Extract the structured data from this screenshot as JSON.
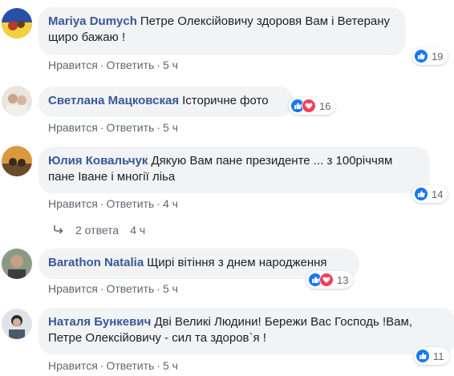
{
  "colors": {
    "author": "#385898",
    "bubble": "#f2f3f5",
    "meta": "#606770",
    "like": "#1877f2",
    "love": "#f33e58"
  },
  "comments": [
    {
      "author": "Mariya Dumych",
      "text": "Петре Олексійовичу здоровя Вам і Ветерану щиро бажаю !",
      "like_label": "Нравится",
      "reply_label": "Ответить",
      "time": "5 ч",
      "reaction_count": "19",
      "reactions": [
        "like-icon"
      ]
    },
    {
      "author": "Светлана Мацковская",
      "text": "Історичне фото",
      "like_label": "Нравится",
      "reply_label": "Ответить",
      "time": "5 ч",
      "reaction_count": "16",
      "reactions": [
        "like-icon",
        "love-icon"
      ]
    },
    {
      "author": "Юлия Ковальчук",
      "text": "Дякую Вам пане президенте ... з 100річчям пане Іване і многії ліьа",
      "like_label": "Нравится",
      "reply_label": "Ответить",
      "time": "4 ч",
      "reaction_count": "14",
      "reactions": [
        "like-icon"
      ]
    },
    {
      "author": "Barathon Natalia",
      "text": "Щирі вітіння з днем народження",
      "like_label": "Нравится",
      "reply_label": "Ответить",
      "time": "5 ч",
      "reaction_count": "13",
      "reactions": [
        "like-icon",
        "love-icon"
      ]
    },
    {
      "author": "Наталя Бункевич",
      "text": "Дві Великі Людини! Бережи Вас Господь !Вам, Петре Олексійовичу - сил та здоров`я !",
      "like_label": "Нравится",
      "reply_label": "Ответить",
      "time": "5 ч",
      "reaction_count": "11",
      "reactions": [
        "like-icon"
      ]
    }
  ],
  "replies_link": {
    "label": "2 ответа",
    "time": "4 ч",
    "icon": "reply-arrow-icon"
  }
}
